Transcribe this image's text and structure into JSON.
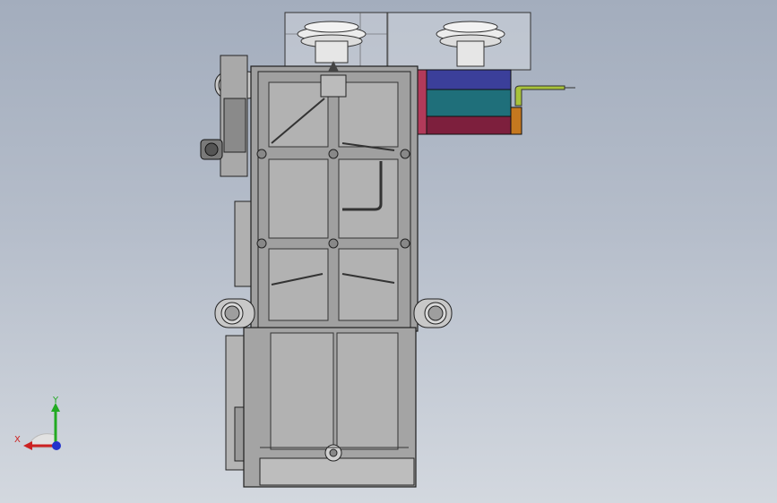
{
  "colors": {
    "background_top": "#a3adbd",
    "background_bottom": "#d3d8df",
    "housing_fill": "#9a9a9a",
    "housing_stroke": "#2a2a2a",
    "transparent_cover": "#d0d4dc",
    "motor_blue": "#3b3f9a",
    "motor_teal": "#1f6f7a",
    "motor_maroon": "#7d1f3d",
    "motor_orange": "#c5781f",
    "cable_green": "#a8c23a",
    "axis_x": "#cc2222",
    "axis_y": "#22aa22",
    "axis_z": "#2233cc"
  },
  "model_view": {
    "name": "gearbox-assembly-front-view"
  },
  "triad": {
    "x_label": "X",
    "y_label": "Y"
  }
}
